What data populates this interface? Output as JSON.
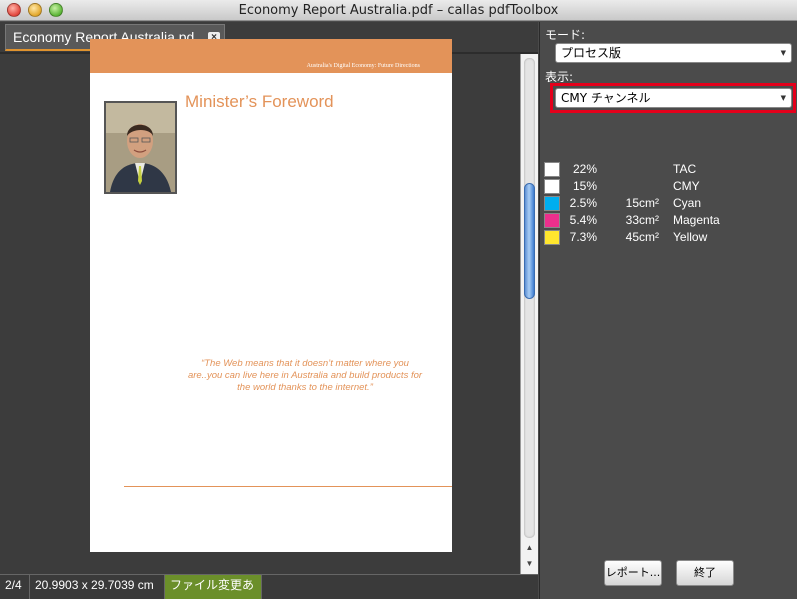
{
  "window": {
    "title": "Economy Report Australia.pdf – callas pdfToolbox"
  },
  "tab": {
    "label": "Economy Report Australia.pd",
    "close_glyph": "×"
  },
  "page": {
    "header_text": "Australia's Digital Economy: Future Directions",
    "title": "Minister’s Foreword",
    "quote": "“The Web means that it doesn’t matter where you are..you can live here in Australia and build products for the world thanks to the internet.”"
  },
  "status": {
    "page": "2/4",
    "size": "20.9903 x 29.7039 cm",
    "modified": "ファイル変更あり"
  },
  "panel": {
    "mode_label": "モード:",
    "mode_value": "プロセス版",
    "view_label": "表示:",
    "view_value": "CMY チャンネル",
    "colors": [
      {
        "pct": "22%",
        "area": "",
        "name": "TAC",
        "color": "#ffffff"
      },
      {
        "pct": "15%",
        "area": "",
        "name": "CMY",
        "color": "#ffffff"
      },
      {
        "pct": "2.5%",
        "area": "15cm²",
        "name": "Cyan",
        "color": "#00aeef"
      },
      {
        "pct": "5.4%",
        "area": "33cm²",
        "name": "Magenta",
        "color": "#ec2f8c"
      },
      {
        "pct": "7.3%",
        "area": "45cm²",
        "name": "Yellow",
        "color": "#ffe62e"
      }
    ],
    "report_button": "レポート...",
    "end_button": "終了"
  },
  "colors": {
    "accent_orange": "#e39359",
    "highlight_red": "#e4001b",
    "modified_green": "#6b8f2a"
  }
}
